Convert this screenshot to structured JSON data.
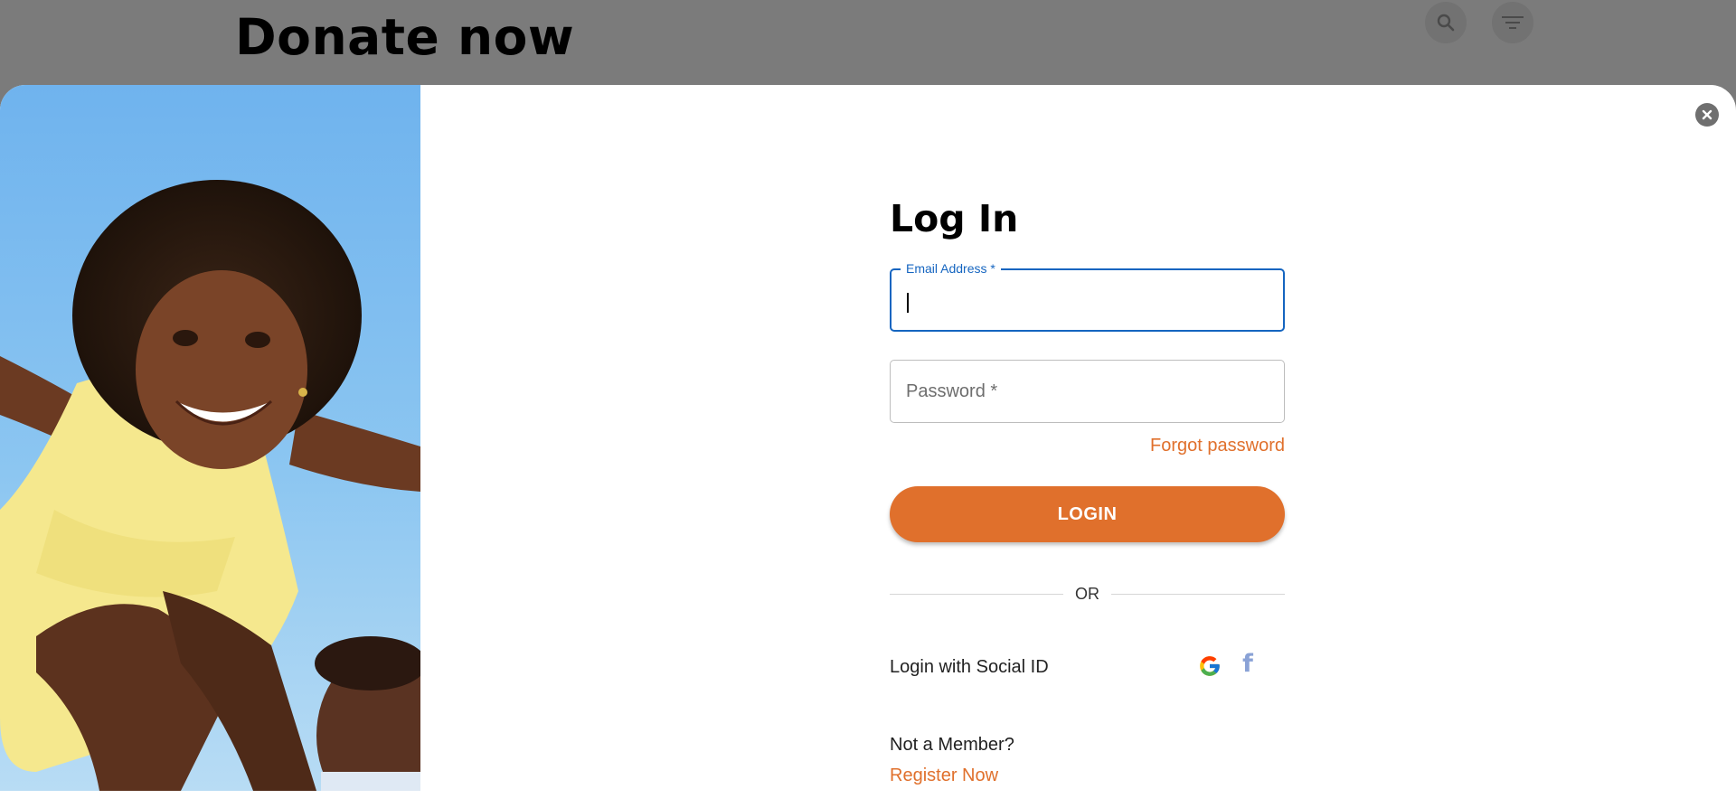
{
  "background_page": {
    "title": "Donate now",
    "icons": [
      "search-icon",
      "filter-icon"
    ]
  },
  "modal": {
    "title": "Log In",
    "email": {
      "label": "Email Address *",
      "value": ""
    },
    "password": {
      "placeholder": "Password *",
      "value": ""
    },
    "forgot_password": "Forgot password",
    "login_button": "LOGIN",
    "divider_text": "OR",
    "social_label": "Login with Social ID",
    "social_icons": [
      "google-icon",
      "facebook-icon"
    ],
    "not_member_text": "Not a Member?",
    "register_link": "Register Now",
    "close_icon": "close-icon",
    "hero_image": "child-being-lifted-photo"
  },
  "colors": {
    "accent_orange": "#e0702c",
    "focus_blue": "#1565c0",
    "overlay_gray": "#7b7b7b"
  }
}
